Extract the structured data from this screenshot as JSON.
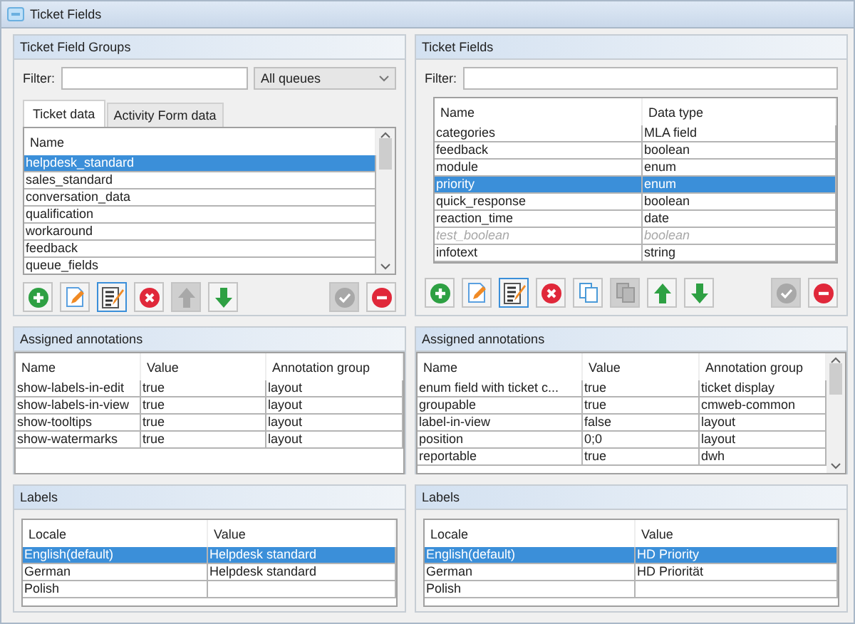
{
  "window": {
    "title": "Ticket Fields"
  },
  "groups_panel": {
    "title": "Ticket Field Groups",
    "filter_label": "Filter:",
    "queue_select": "All queues",
    "tabs": [
      {
        "label": "Ticket data",
        "selected": true
      },
      {
        "label": "Activity Form data",
        "selected": false
      }
    ],
    "columns": [
      "Name"
    ],
    "rows": [
      {
        "name": "helpdesk_standard",
        "selected": true
      },
      {
        "name": "sales_standard",
        "selected": false
      },
      {
        "name": "conversation_data",
        "selected": false
      },
      {
        "name": "qualification",
        "selected": false
      },
      {
        "name": "workaround",
        "selected": false
      },
      {
        "name": "feedback",
        "selected": false
      },
      {
        "name": "queue_fields",
        "selected": false
      }
    ],
    "buttons": [
      {
        "kind": "add",
        "disabled": false
      },
      {
        "kind": "edit",
        "disabled": false
      },
      {
        "kind": "edit-doc",
        "disabled": false
      },
      {
        "kind": "delete",
        "disabled": false
      },
      {
        "kind": "up",
        "disabled": true
      },
      {
        "kind": "down",
        "disabled": false
      },
      {
        "kind": "confirm",
        "disabled": true
      },
      {
        "kind": "remove",
        "disabled": false
      }
    ]
  },
  "fields_panel": {
    "title": "Ticket Fields",
    "filter_label": "Filter:",
    "columns": [
      "Name",
      "Data type"
    ],
    "rows": [
      {
        "cells": [
          "categories",
          "MLA field"
        ],
        "selected": false,
        "disabled": false
      },
      {
        "cells": [
          "feedback",
          "boolean"
        ],
        "selected": false,
        "disabled": false
      },
      {
        "cells": [
          "module",
          "enum"
        ],
        "selected": false,
        "disabled": false
      },
      {
        "cells": [
          "priority",
          "enum"
        ],
        "selected": true,
        "disabled": false
      },
      {
        "cells": [
          "quick_response",
          "boolean"
        ],
        "selected": false,
        "disabled": false
      },
      {
        "cells": [
          "reaction_time",
          "date"
        ],
        "selected": false,
        "disabled": false
      },
      {
        "cells": [
          "test_boolean",
          "boolean"
        ],
        "selected": false,
        "disabled": true
      },
      {
        "cells": [
          "infotext",
          "string"
        ],
        "selected": false,
        "disabled": false
      }
    ],
    "buttons": [
      {
        "kind": "add",
        "disabled": false
      },
      {
        "kind": "edit",
        "disabled": false
      },
      {
        "kind": "edit-doc",
        "disabled": false
      },
      {
        "kind": "delete",
        "disabled": false
      },
      {
        "kind": "copy",
        "disabled": false
      },
      {
        "kind": "paste",
        "disabled": true
      },
      {
        "kind": "up",
        "disabled": false
      },
      {
        "kind": "down",
        "disabled": false
      },
      {
        "kind": "confirm",
        "disabled": true
      },
      {
        "kind": "remove",
        "disabled": false
      }
    ]
  },
  "annotations": [
    {
      "title": "Assigned annotations",
      "columns": [
        "Name",
        "Value",
        "Annotation group"
      ],
      "rows": [
        {
          "cells": [
            "show-labels-in-edit",
            "true",
            "layout"
          ]
        },
        {
          "cells": [
            "show-labels-in-view",
            "true",
            "layout"
          ]
        },
        {
          "cells": [
            "show-tooltips",
            "true",
            "layout"
          ]
        },
        {
          "cells": [
            "show-watermarks",
            "true",
            "layout"
          ]
        }
      ]
    },
    {
      "title": "Assigned annotations",
      "columns": [
        "Name",
        "Value",
        "Annotation group"
      ],
      "rows": [
        {
          "cells": [
            "enum field with ticket c...",
            "true",
            "ticket display"
          ]
        },
        {
          "cells": [
            "groupable",
            "true",
            "cmweb-common"
          ]
        },
        {
          "cells": [
            "label-in-view",
            "false",
            "layout"
          ]
        },
        {
          "cells": [
            "position",
            "0;0",
            "layout"
          ]
        },
        {
          "cells": [
            "reportable",
            "true",
            "dwh"
          ]
        }
      ]
    }
  ],
  "labels": [
    {
      "title": "Labels",
      "columns": [
        "Locale",
        "Value"
      ],
      "rows": [
        {
          "cells": [
            "English(default)",
            "Helpdesk standard"
          ],
          "selected": true
        },
        {
          "cells": [
            "German",
            "Helpdesk standard"
          ],
          "selected": false
        },
        {
          "cells": [
            "Polish",
            ""
          ],
          "selected": false
        }
      ]
    },
    {
      "title": "Labels",
      "columns": [
        "Locale",
        "Value"
      ],
      "rows": [
        {
          "cells": [
            "English(default)",
            "HD Priority"
          ],
          "selected": true
        },
        {
          "cells": [
            "German",
            "HD Priorität"
          ],
          "selected": false
        },
        {
          "cells": [
            "Polish",
            ""
          ],
          "selected": false
        }
      ]
    }
  ]
}
